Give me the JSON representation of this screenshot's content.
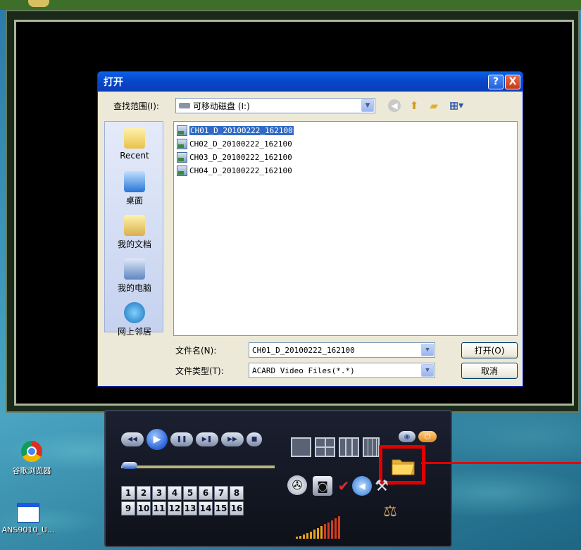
{
  "dialog": {
    "title": "打开",
    "lookin_label": "查找范围(I):",
    "lookin_value": "可移动磁盘 (I:)",
    "places": [
      "Recent",
      "桌面",
      "我的文档",
      "我的电脑",
      "网上邻居"
    ],
    "files": [
      "CH01_D_20100222_162100",
      "CH02_D_20100222_162100",
      "CH03_D_20100222_162100",
      "CH04_D_20100222_162100"
    ],
    "selected_file_index": 0,
    "filename_label": "文件名(N):",
    "filename_value": "CH01_D_20100222_162100",
    "filetype_label": "文件类型(T):",
    "filetype_value": "ACARD Video Files(*.*)",
    "open_button": "打开(O)",
    "cancel_button": "取消",
    "help_glyph": "?",
    "close_glyph": "X"
  },
  "player": {
    "channels_row1": [
      "1",
      "2",
      "3",
      "4",
      "5",
      "6",
      "7",
      "8"
    ],
    "channels_row2": [
      "9",
      "10",
      "11",
      "12",
      "13",
      "14",
      "15",
      "16"
    ],
    "highlight_color": "#e00000"
  },
  "desktop": {
    "browser_label": "谷歌浏览器",
    "app_label": "ANS9010_U..."
  }
}
